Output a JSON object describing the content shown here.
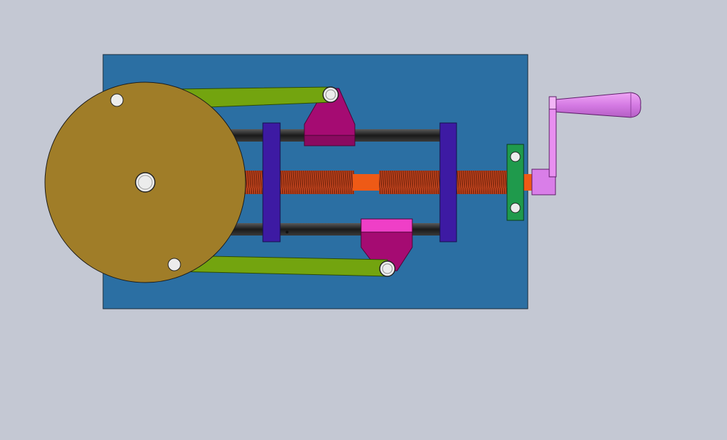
{
  "scene": {
    "description_label": "",
    "colors": {
      "background": "#c4c8d3",
      "base_plate": "#2b6fa3",
      "disc": "#a07d28",
      "links": "#73a40f",
      "clamp_brackets": "#a50b72",
      "clamp_top_cap": "#ef3fc7",
      "guide_plates": "#3d1aa3",
      "guide_rods": "#2a2a2a",
      "threaded_rod": "#c2461f",
      "shaft_center": "#ee5a16",
      "bearing_block": "#1f9a4c",
      "crank_arm": "#e88ff0",
      "crank_handle": "#d97ee8",
      "pin": "#ececec"
    },
    "icons": [
      "disc-icon",
      "crank-handle-icon",
      "threaded-rod-icon"
    ]
  }
}
